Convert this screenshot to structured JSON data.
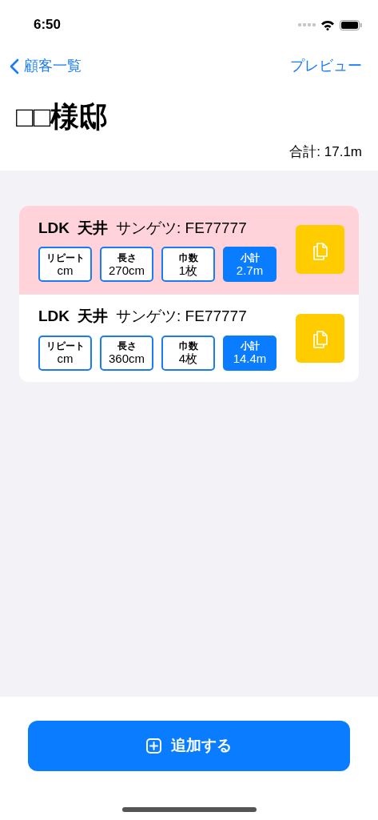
{
  "status_bar": {
    "time": "6:50"
  },
  "nav": {
    "back_label": "顧客一覧",
    "action_label": "プレビュー"
  },
  "title": "□□様邸",
  "total": "合計: 17.1m",
  "items": [
    {
      "room": "LDK",
      "place": "天井",
      "product": "サンゲツ: FE77777",
      "selected": true,
      "fields": [
        {
          "kind": "field",
          "label": "リピート",
          "value": "cm"
        },
        {
          "kind": "field",
          "label": "長さ",
          "value": "270cm"
        },
        {
          "kind": "field",
          "label": "巾数",
          "value": "1枚"
        },
        {
          "kind": "total",
          "label": "小計",
          "value": "2.7m"
        }
      ]
    },
    {
      "room": "LDK",
      "place": "天井",
      "product": "サンゲツ: FE77777",
      "selected": false,
      "fields": [
        {
          "kind": "field",
          "label": "リピート",
          "value": "cm"
        },
        {
          "kind": "field",
          "label": "長さ",
          "value": "360cm"
        },
        {
          "kind": "field",
          "label": "巾数",
          "value": "4枚"
        },
        {
          "kind": "total",
          "label": "小計",
          "value": "14.4m"
        }
      ]
    }
  ],
  "add_button": "追加する"
}
